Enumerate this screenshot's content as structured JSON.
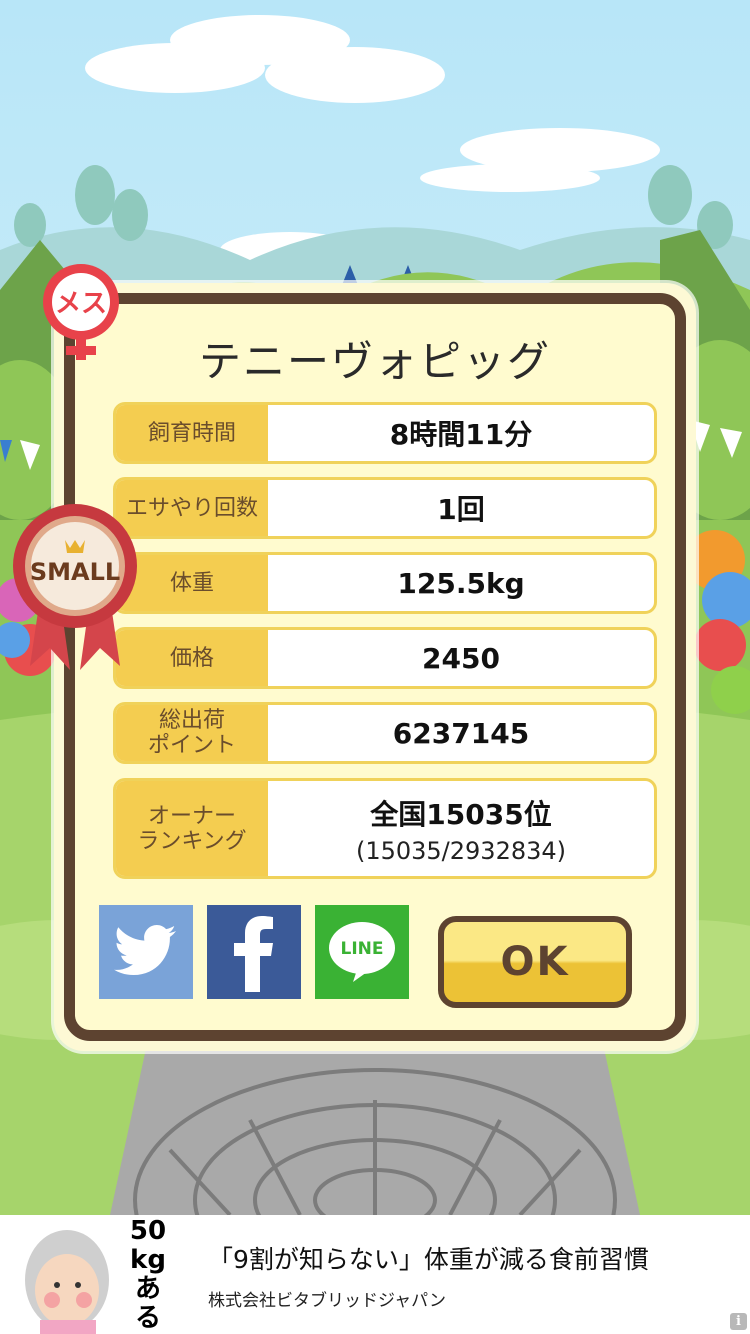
{
  "pig": {
    "name": "テニーヴォピッグ",
    "gender_label": "メス",
    "size_badge": "SMALL"
  },
  "stats": [
    {
      "label": "飼育時間",
      "value": "8時間11分"
    },
    {
      "label": "エサやり回数",
      "value": "1回"
    },
    {
      "label": "体重",
      "value": "125.5kg"
    },
    {
      "label": "価格",
      "value": "2450"
    },
    {
      "label": "総出荷\nポイント",
      "value": "6237145"
    },
    {
      "label": "オーナー\nランキング",
      "value": "全国15035位",
      "sub": "(15035/2932834)"
    }
  ],
  "share": {
    "twitter_color": "#7aa3d8",
    "facebook_color": "#3b5a98",
    "line_color": "#3ab234",
    "line_label": "LINE"
  },
  "ok_label": "OK",
  "ad": {
    "headline": "「9割が知らない」体重が減る食前習慣",
    "company": "株式会社ビタブリッドジャパン",
    "weight_line1": "50",
    "weight_line2": "kg",
    "weight_line3": "ある",
    "info_label": "i"
  }
}
